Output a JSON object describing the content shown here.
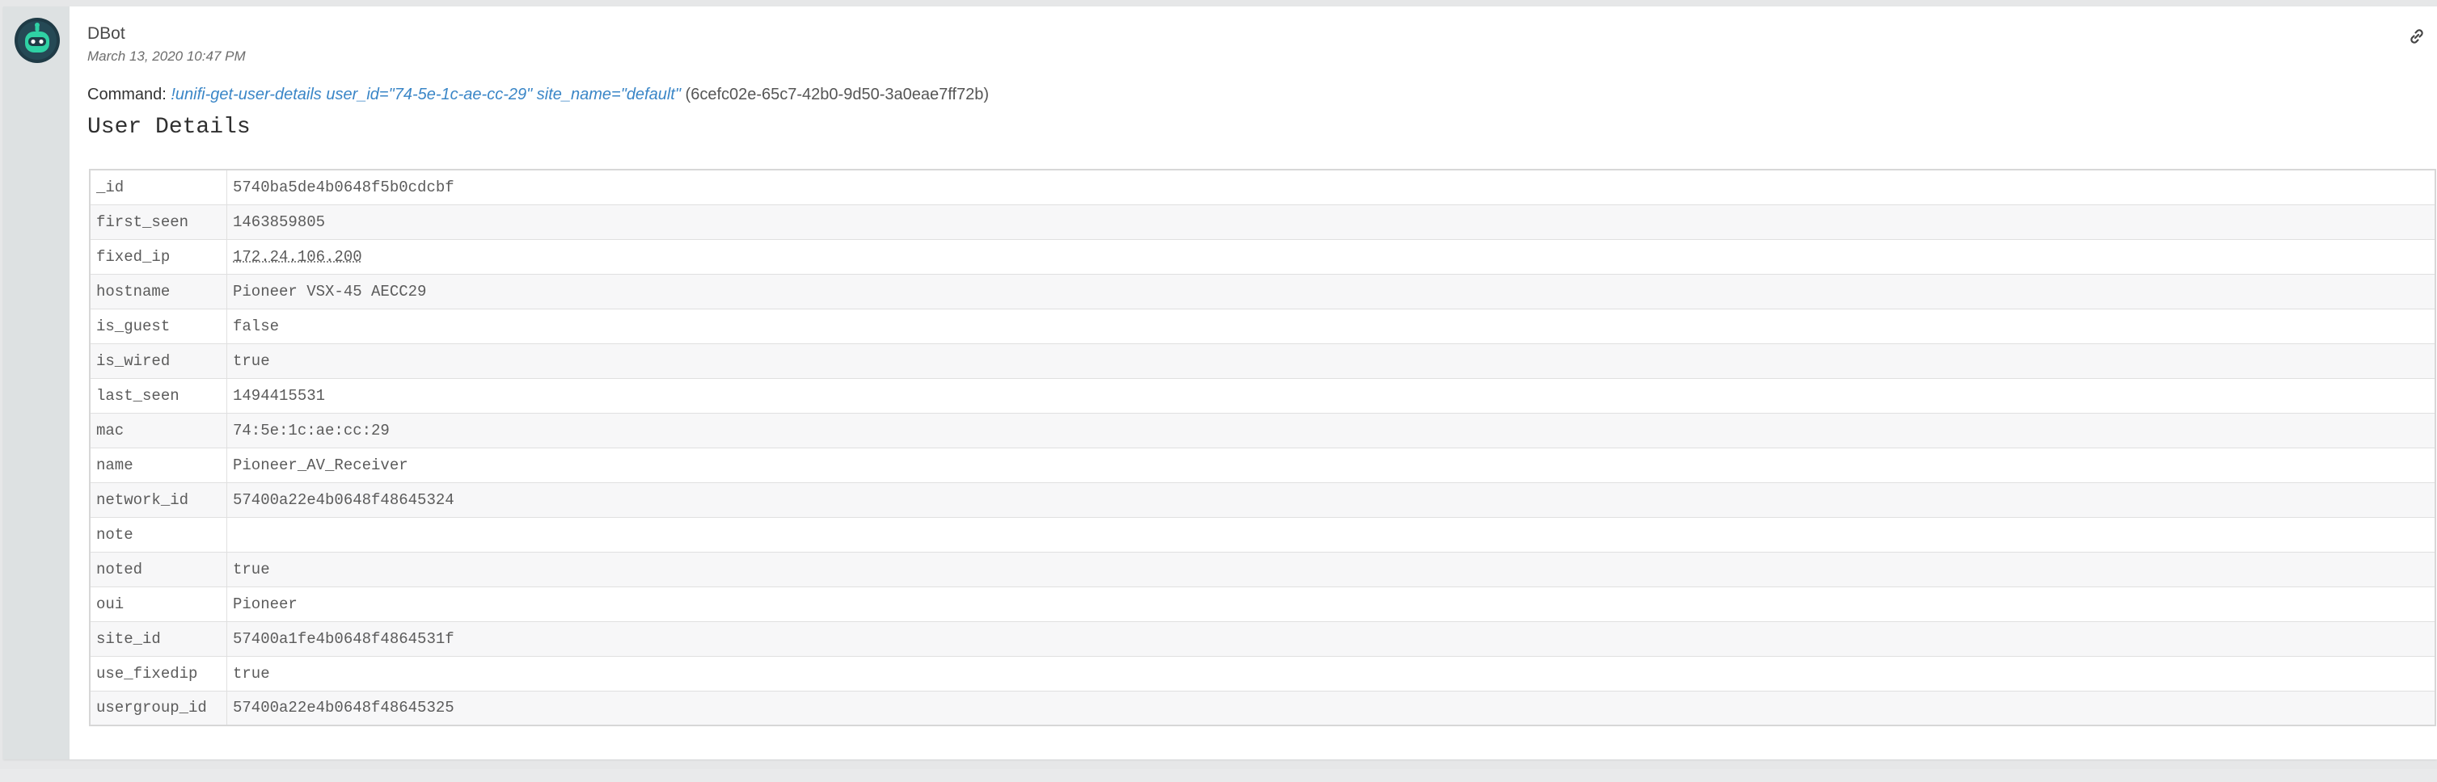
{
  "entry": {
    "author": "DBot",
    "timestamp": "March 13, 2020 10:47 PM",
    "avatar_icon": "robot-icon",
    "link_icon": "link-icon",
    "command": {
      "label": "Command:",
      "text": "!unifi-get-user-details user_id=\"74-5e-1c-ae-cc-29\" site_name=\"default\"",
      "id": "(6cefc02e-65c7-42b0-9d50-3a0eae7ff72b)"
    },
    "section_title": "User Details",
    "colors": {
      "command_link": "#3a86c7",
      "gutter": "#dde1e2",
      "avatar_bg": "#1f3b46",
      "avatar_accent": "#2fd1a4"
    }
  },
  "user_details": {
    "rows": [
      {
        "key": "_id",
        "value": "5740ba5de4b0648f5b0cdcbf"
      },
      {
        "key": "first_seen",
        "value": "1463859805"
      },
      {
        "key": "fixed_ip",
        "value": "172.24.106.200"
      },
      {
        "key": "hostname",
        "value": "Pioneer VSX-45 AECC29"
      },
      {
        "key": "is_guest",
        "value": "false"
      },
      {
        "key": "is_wired",
        "value": "true"
      },
      {
        "key": "last_seen",
        "value": "1494415531"
      },
      {
        "key": "mac",
        "value": "74:5e:1c:ae:cc:29"
      },
      {
        "key": "name",
        "value": "Pioneer_AV_Receiver"
      },
      {
        "key": "network_id",
        "value": "57400a22e4b0648f48645324"
      },
      {
        "key": "note",
        "value": ""
      },
      {
        "key": "noted",
        "value": "true"
      },
      {
        "key": "oui",
        "value": "Pioneer"
      },
      {
        "key": "site_id",
        "value": "57400a1fe4b0648f4864531f"
      },
      {
        "key": "use_fixedip",
        "value": "true"
      },
      {
        "key": "usergroup_id",
        "value": "57400a22e4b0648f48645325"
      }
    ]
  }
}
